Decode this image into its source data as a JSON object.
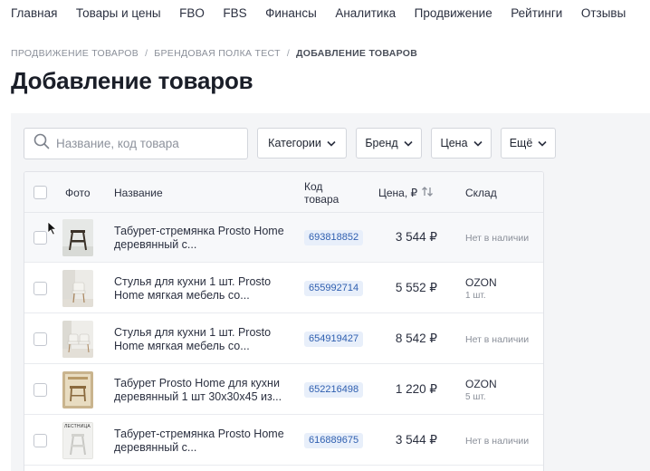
{
  "topnav": {
    "items": [
      "Главная",
      "Товары и цены",
      "FBO",
      "FBS",
      "Финансы",
      "Аналитика",
      "Продвижение",
      "Рейтинги",
      "Отзывы"
    ]
  },
  "breadcrumb": {
    "items": [
      "ПРОДВИЖЕНИЕ ТОВАРОВ",
      "БРЕНДОВАЯ ПОЛКА ТЕСТ",
      "ДОБАВЛЕНИЕ ТОВАРОВ"
    ],
    "separator": "/"
  },
  "page": {
    "title": "Добавление товаров"
  },
  "search": {
    "placeholder": "Название, код товара",
    "value": ""
  },
  "filters": [
    "Категории",
    "Бренд",
    "Цена",
    "Ещё"
  ],
  "table": {
    "columns": {
      "photo": "Фото",
      "name": "Название",
      "code": "Код\nтовара",
      "price": "Цена, ₽",
      "stock": "Склад"
    },
    "rows": [
      {
        "name": "Табурет-стремянка Prosto Home деревянный с...",
        "code": "693818852",
        "price": "3 544 ₽",
        "stock": "Нет в наличии",
        "stock_sub": "",
        "thumb": "stool-ladder"
      },
      {
        "name": "Стулья для кухни 1 шт. Prosto Home мягкая мебель со...",
        "code": "655992714",
        "price": "5 552 ₽",
        "stock": "OZON",
        "stock_sub": "1 шт.",
        "thumb": "kitchen-chair"
      },
      {
        "name": "Стулья для кухни 1 шт. Prosto Home мягкая мебель со...",
        "code": "654919427",
        "price": "8 542 ₽",
        "stock": "Нет в наличии",
        "stock_sub": "",
        "thumb": "kitchen-chair"
      },
      {
        "name": "Табурет Prosto Home для кухни деревянный 1 шт 30х30х45 из...",
        "code": "652216498",
        "price": "1 220 ₽",
        "stock": "OZON",
        "stock_sub": "5 шт.",
        "thumb": "wooden-stool"
      },
      {
        "name": "Табурет-стремянка Prosto Home деревянный с...",
        "code": "616889675",
        "price": "3 544 ₽",
        "stock": "Нет в наличии",
        "stock_sub": "",
        "thumb": "stool-ladder-white",
        "thumb_caption": "ЛЕСТНИЦА"
      }
    ]
  },
  "colors": {
    "accent": "#2f5fb0",
    "code_bg": "#e8effa",
    "panel_bg": "#f4f5f7"
  }
}
